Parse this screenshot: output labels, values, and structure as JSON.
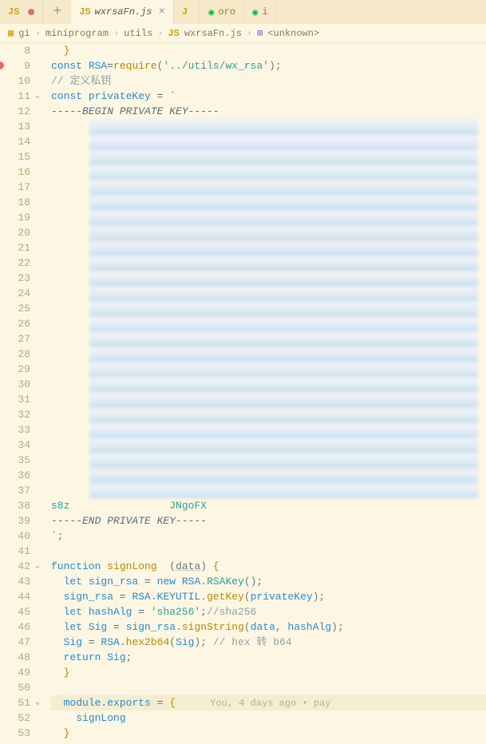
{
  "tabs": [
    {
      "icon": "JS",
      "label": "",
      "modified": true
    },
    {
      "icon": "JS",
      "label": "wxrsaFn.js",
      "active": true
    },
    {
      "icon": "J",
      "label": ""
    },
    {
      "icon": "wechat",
      "label": "oro"
    },
    {
      "icon": "wechat",
      "label": "i"
    }
  ],
  "breadcrumb": {
    "root_icon": "gi",
    "parts": [
      "miniprogram",
      "utils",
      "wxrsaFn.js",
      "<unknown>"
    ],
    "js_icon": "JS",
    "brackets_icon": "⊞"
  },
  "line_numbers": [
    8,
    9,
    10,
    11,
    12,
    13,
    14,
    15,
    16,
    17,
    18,
    19,
    20,
    21,
    22,
    23,
    24,
    25,
    26,
    27,
    28,
    29,
    30,
    31,
    32,
    33,
    34,
    35,
    36,
    37,
    38,
    39,
    40,
    41,
    42,
    43,
    44,
    45,
    46,
    47,
    48,
    49,
    50,
    51,
    52,
    53
  ],
  "code": {
    "l8": "  }",
    "l9_const": "const",
    "l9_rsa": "RSA",
    "l9_eq": "=",
    "l9_require": "require",
    "l9_path": "'../utils/wx_rsa'",
    "l9_end": ");",
    "l10_comment": "// 定义私钥",
    "l11_const": "const",
    "l11_var": "privateKey",
    "l11_eq": " = `",
    "l12_text": "-----BEGIN PRIVATE KEY-----",
    "l38_prefix": "s8z",
    "l38_mid": "                JNgoFX",
    "l39_text": "-----END PRIVATE KEY-----",
    "l40_text": "`;",
    "l42_function": "function",
    "l42_name": "signLong",
    "l42_param": "data",
    "l42_brace": " {",
    "l43_let": "let",
    "l43_var": "sign_rsa",
    "l43_eq": " = ",
    "l43_new": "new",
    "l43_rsa": "RSA",
    "l43_rsakey": "RSAKey",
    "l43_end": "();",
    "l44_var": "sign_rsa",
    "l44_eq": " = ",
    "l44_rsa": "RSA",
    "l44_keyutil": "KEYUTIL",
    "l44_getkey": "getKey",
    "l44_pk": "privateKey",
    "l44_end": ");",
    "l45_let": "let",
    "l45_var": "hashAlg",
    "l45_eq": " = ",
    "l45_val": "'sha256'",
    "l45_semi": ";",
    "l45_comment": "//sha256",
    "l46_let": "let",
    "l46_var": "Sig",
    "l46_eq": " = ",
    "l46_sr": "sign_rsa",
    "l46_ss": "signString",
    "l46_d": "data",
    "l46_c": ", ",
    "l46_h": "hashAlg",
    "l46_end": ");",
    "l47_var": "Sig",
    "l47_eq": " = ",
    "l47_rsa": "RSA",
    "l47_fn": "hex2b64",
    "l47_arg": "Sig",
    "l47_end": "); ",
    "l47_comment": "// hex 转 b64",
    "l48_return": "return",
    "l48_var": "Sig",
    "l48_end": ";",
    "l49_brace": "}",
    "l51_module": "module",
    "l51_exports": "exports",
    "l51_eq": " = ",
    "l51_brace": "{",
    "l51_lens": "      You, 4 days ago • pay",
    "l52_var": "signLong",
    "l53_brace": "}"
  }
}
